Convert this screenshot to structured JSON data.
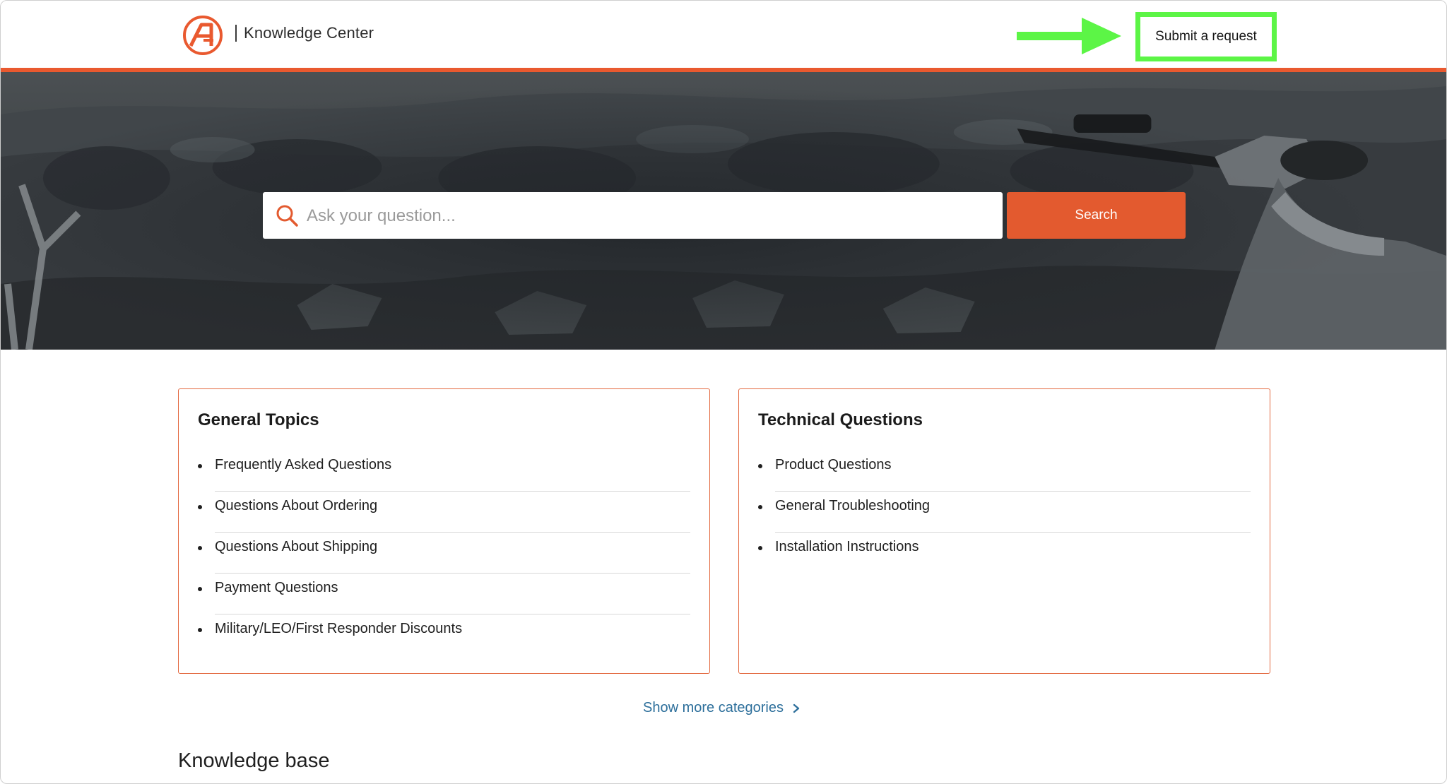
{
  "header": {
    "brand": "Knowledge Center",
    "submit_label": "Submit a request"
  },
  "colors": {
    "accent": "#e9592f",
    "highlight": "#5cf546",
    "link": "#2d6f9b"
  },
  "search": {
    "placeholder": "Ask your question...",
    "value": "",
    "button_label": "Search"
  },
  "categories": [
    {
      "title": "General Topics",
      "items": [
        "Frequently Asked Questions",
        "Questions About Ordering",
        "Questions About Shipping",
        "Payment Questions",
        "Military/LEO/First Responder Discounts"
      ]
    },
    {
      "title": "Technical Questions",
      "items": [
        "Product Questions",
        "General Troubleshooting",
        "Installation Instructions"
      ]
    }
  ],
  "more_categories_label": "Show more categories",
  "knowledge_base_title": "Knowledge base",
  "icons": [
    "brand-logo-icon",
    "arrow-right-icon",
    "search-icon",
    "chevron-right-icon"
  ]
}
